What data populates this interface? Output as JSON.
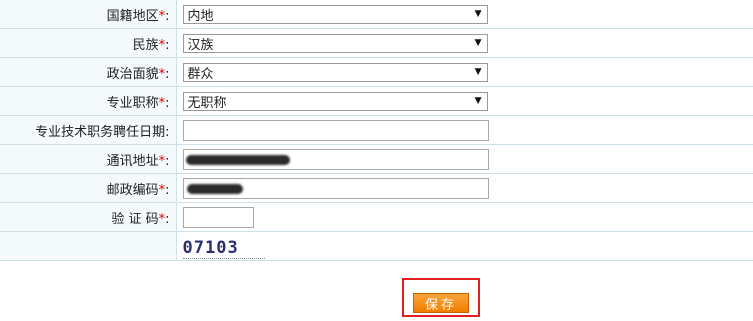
{
  "form": {
    "rows": [
      {
        "label": "国籍地区",
        "required": "*",
        "colon": ":",
        "value": "内地"
      },
      {
        "label": "民族",
        "required": "*",
        "colon": ":",
        "value": "汉族"
      },
      {
        "label": "政治面貌",
        "required": "*",
        "colon": ":",
        "value": "群众"
      },
      {
        "label": "专业职称",
        "required": "*",
        "colon": ":",
        "value": "无职称"
      },
      {
        "label": "专业技术职务聘任日期",
        "colon": ":",
        "value": ""
      },
      {
        "label": "通讯地址",
        "required": "*",
        "colon": ":",
        "value": ""
      },
      {
        "label": "邮政编码",
        "required": "*",
        "colon": ":",
        "value": ""
      },
      {
        "label": "验 证 码",
        "required": "*",
        "colon": ":",
        "value": ""
      }
    ],
    "captcha_text": "07103"
  },
  "actions": {
    "save_label": "保存",
    "highlight_color": "#e02020"
  }
}
